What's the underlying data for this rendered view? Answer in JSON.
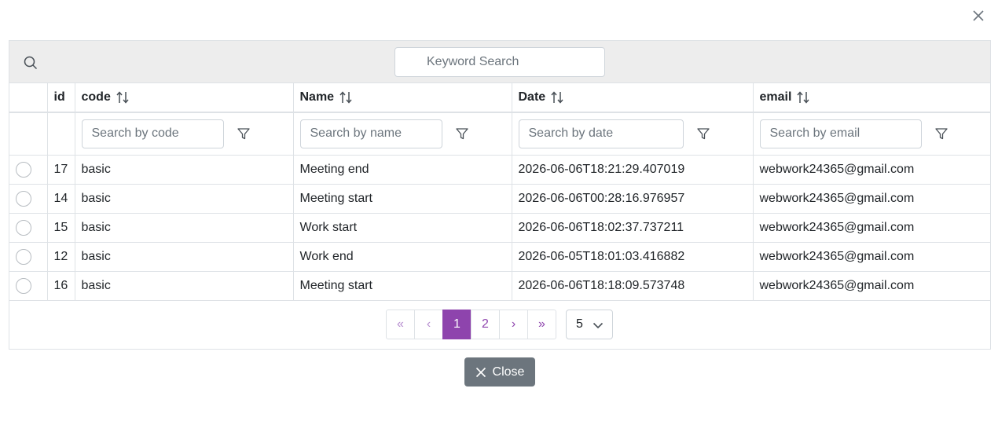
{
  "dialog": {
    "close_icon": "close-icon"
  },
  "toolbar": {
    "search_icon": "search-icon",
    "keyword_placeholder": "Keyword Search"
  },
  "columns": [
    {
      "key": "select",
      "label": ""
    },
    {
      "key": "id",
      "label": "id",
      "sortable": false
    },
    {
      "key": "code",
      "label": "code",
      "sortable": true,
      "filter_placeholder": "Search by code"
    },
    {
      "key": "name",
      "label": "Name",
      "sortable": true,
      "filter_placeholder": "Search by name"
    },
    {
      "key": "date",
      "label": "Date",
      "sortable": true,
      "filter_placeholder": "Search by date"
    },
    {
      "key": "email",
      "label": "email",
      "sortable": true,
      "filter_placeholder": "Search by email"
    }
  ],
  "rows": [
    {
      "id": "17",
      "code": "basic",
      "name": "Meeting end",
      "date": "2026-06-06T18:21:29.407019",
      "email": "webwork24365@gmail.com"
    },
    {
      "id": "14",
      "code": "basic",
      "name": "Meeting start",
      "date": "2026-06-06T00:28:16.976957",
      "email": "webwork24365@gmail.com"
    },
    {
      "id": "15",
      "code": "basic",
      "name": "Work start",
      "date": "2026-06-06T18:02:37.737211",
      "email": "webwork24365@gmail.com"
    },
    {
      "id": "12",
      "code": "basic",
      "name": "Work end",
      "date": "2026-06-05T18:01:03.416882",
      "email": "webwork24365@gmail.com"
    },
    {
      "id": "16",
      "code": "basic",
      "name": "Meeting start",
      "date": "2026-06-06T18:18:09.573748",
      "email": "webwork24365@gmail.com"
    }
  ],
  "pagination": {
    "first": "«",
    "prev": "‹",
    "next": "›",
    "last": "»",
    "pages": [
      "1",
      "2"
    ],
    "current": "1",
    "rows_per_page": "5"
  },
  "footer": {
    "close_label": "Close"
  },
  "colors": {
    "accent": "#8e44ad",
    "accent_muted": "#b68ccf",
    "toolbar_bg": "#ededed",
    "close_button": "#6c757d"
  }
}
